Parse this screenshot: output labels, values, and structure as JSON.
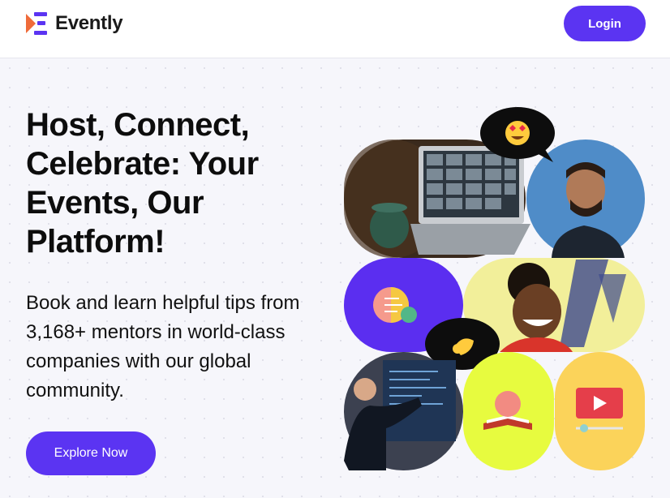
{
  "header": {
    "brand": "Evently",
    "login_label": "Login"
  },
  "hero": {
    "headline": "Host, Connect, Celebrate: Your Events, Our Platform!",
    "subtext": "Book and learn helpful tips from 3,168+ mentors in world-class companies with our global community.",
    "cta_label": "Explore Now"
  },
  "collage": {
    "emoji_1": "heart-eyes-emoji",
    "emoji_2": "pinching-hand-emoji",
    "tiles": [
      "video-call-laptop-photo",
      "laughing-man-photo",
      "brain-lightbulb-icon",
      "smiling-woman-photo",
      "presenter-at-screen-photo",
      "brain-book-icon",
      "video-player-icon"
    ]
  },
  "colors": {
    "accent": "#5b34f2",
    "logo_orange": "#ef6b3a",
    "tile_purple": "#5b2ef0",
    "tile_lime": "#e7fb3f",
    "tile_yellow": "#fbd35a"
  }
}
